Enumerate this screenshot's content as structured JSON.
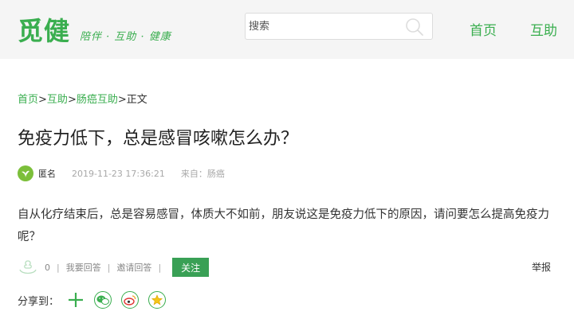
{
  "header": {
    "logo": "觅健",
    "slogan": "陪伴 · 互助 · 健康",
    "search_placeholder": "搜索",
    "nav": [
      "首页",
      "互助"
    ]
  },
  "breadcrumb": {
    "items": [
      "首页",
      "互助",
      "肠癌互助"
    ],
    "separator": ">",
    "current": "正文"
  },
  "post": {
    "title": "免疫力低下，总是感冒咳嗽怎么办？",
    "author": "匿名",
    "date": "2019-11-23 17:36:21",
    "source": "来自：肠癌",
    "content": "自从化疗结束后，总是容易感冒，体质大不如前，朋友说这是免疫力低下的原因，请问要怎么提高免疫力呢？"
  },
  "actions": {
    "like_count": "0",
    "answer_label": "我要回答",
    "invite_label": "邀请回答",
    "follow_label": "关注",
    "report_label": "举报",
    "separator": "|"
  },
  "share": {
    "label": "分享到：",
    "targets": [
      "more",
      "wechat",
      "weibo",
      "qzone"
    ]
  },
  "colors": {
    "brand_green": "#3aae4f",
    "follow_bg": "#39a055",
    "header_bg": "#f5f5f5",
    "meta_gray": "#a8a8a8"
  }
}
